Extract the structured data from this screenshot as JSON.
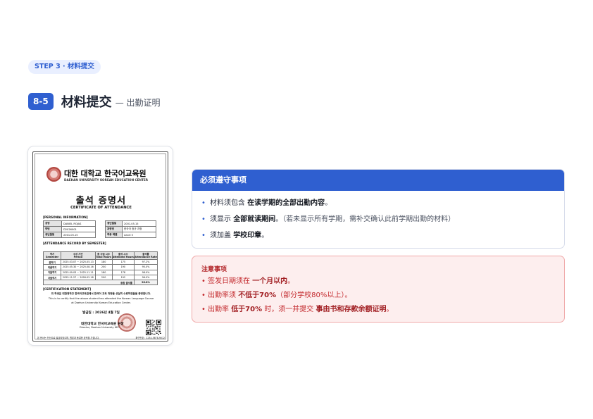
{
  "step_pill": "STEP 3 · 材料提交",
  "title": {
    "badge": "8-5",
    "main": "材料提交",
    "sub": "— 出勤证明"
  },
  "certificate": {
    "institution_ko": "대한 대학교 한국어교육원",
    "institution_en": "DAEHAN UNIVERSITY KOREAN EDUCATION CENTER",
    "doc_title_ko": "출석 증명서",
    "doc_title_en": "CERTIFICATE OF ATTENDANCE",
    "personal_section": "[PERSONAL INFORMATION]",
    "personal": {
      "name_label": "성명",
      "name_value": "DANIEL ROJAS",
      "id_label": "학번",
      "id_value": "D2026001",
      "birth_label": "생년월일",
      "birth_value": "2001.05.15",
      "enroll_label": "생년월일",
      "enroll_value": "2001.05.15",
      "course_label": "과정명",
      "course_value": "한국어 정규 과정",
      "level_label": "최종 레벨",
      "level_value": "Level 5"
    },
    "attendance_section": "[ATTENDANCE RECORD BY SEMESTER]",
    "attendance_headers": [
      {
        "ko": "학기",
        "en": "Semester"
      },
      {
        "ko": "수강 기간",
        "en": "Period"
      },
      {
        "ko": "총 수업 시수",
        "en": "Total Hours"
      },
      {
        "ko": "출석 시수",
        "en": "Attended Hours"
      },
      {
        "ko": "출석률",
        "en": "Attendance Rate"
      }
    ],
    "attendance_rows": [
      {
        "semester": "봄학기",
        "period": "2025.03.07 ~ 2025.05.13",
        "total": "180",
        "attended": "175",
        "rate": "97.2%"
      },
      {
        "semester": "여름학기",
        "period": "2025.05.30 ~ 2025.08.16",
        "total": "200",
        "attended": "190",
        "rate": "95.0%"
      },
      {
        "semester": "가을학기",
        "period": "2025.09.03 ~ 2025.11.11",
        "total": "180",
        "attended": "178",
        "rate": "98.9%"
      },
      {
        "semester": "겨울학기",
        "period": "2025.11.27 ~ 2026.02.18",
        "total": "200",
        "attended": "192",
        "rate": "96.0%"
      }
    ],
    "total_label": "종합 출석률",
    "total_value": "96.8%",
    "cert_section": "[CERTIFICATION STATEMENT]",
    "statement_ko": "위 학생은 대한대학교 한국어교육원에서 한국어 교육 과정을 성실히 수료하였음을 증명합니다.",
    "statement_en_1": "This is to certify that the above student has attended the Korean Language Course",
    "statement_en_2": "at Daehan University Korean Education Center.",
    "issue_date": "발급일 : 2026년 4월 7일",
    "signer_ko": "대한대학교 한국어교육원 원장",
    "signer_en": "Director, Daehan University KEC",
    "footer_left": "본 문서는 전산으로 발급되었으며, 원본과 동일한 효력을 가집니다.",
    "footer_right": "확인번호 : 1234-5678-9012"
  },
  "required": {
    "heading": "必须遵守事项",
    "items": [
      {
        "pre": "材料须包含 ",
        "strong": "在读学期的全部出勤内容",
        "post": "。",
        "note": ""
      },
      {
        "pre": "须显示 ",
        "strong": "全部就读期间",
        "post": "。",
        "note": "（若未显示所有学期，需补交确认此前学期出勤的材料）"
      },
      {
        "pre": "须加盖 ",
        "strong": "学校印章",
        "post": "。",
        "note": ""
      }
    ]
  },
  "caution": {
    "heading": "注意事项",
    "items": [
      {
        "pre": "签发日期须在 ",
        "strong": "一个月以内",
        "mid": "。",
        "strong2": "",
        "post": ""
      },
      {
        "pre": "出勤率须 ",
        "strong": "不低于70%",
        "mid": "（部分学校80%以上）。",
        "strong2": "",
        "post": ""
      },
      {
        "pre": "出勤率 ",
        "strong": "低于70%",
        "mid": " 时，须一并提交 ",
        "strong2": "事由书和存款余额证明",
        "post": "。"
      }
    ]
  },
  "colors": {
    "accent": "#2f5fd0",
    "caution_text": "#c3282c",
    "caution_bg": "#fdeeee"
  }
}
